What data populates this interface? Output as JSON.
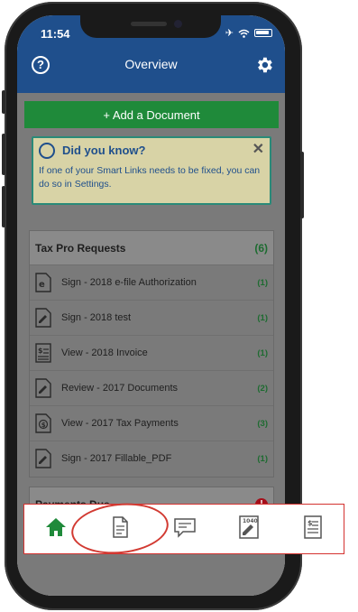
{
  "status_bar": {
    "time": "11:54"
  },
  "nav": {
    "title": "Overview",
    "help_glyph": "?",
    "left_icon": "help-circle-icon",
    "right_icon": "gear-icon"
  },
  "add_document": {
    "label": "+ Add a Document"
  },
  "tip": {
    "title": "Did you know?",
    "body": "If one of your Smart Links needs to be fixed, you can do so in Settings.",
    "close_glyph": "✕"
  },
  "requests": {
    "title": "Tax Pro Requests",
    "count": "(6)",
    "items": [
      {
        "label": "Sign - 2018 e-file Authorization",
        "count": "(1)",
        "icon": "e-file-document-icon"
      },
      {
        "label": "Sign - 2018 test",
        "count": "(1)",
        "icon": "sign-document-icon"
      },
      {
        "label": "View - 2018 Invoice",
        "count": "(1)",
        "icon": "invoice-icon"
      },
      {
        "label": "Review - 2017 Documents",
        "count": "(2)",
        "icon": "review-document-icon"
      },
      {
        "label": "View - 2017 Tax Payments",
        "count": "(3)",
        "icon": "tax-payment-icon"
      },
      {
        "label": "Sign - 2017 Fillable_PDF",
        "count": "(1)",
        "icon": "sign-document-icon"
      }
    ]
  },
  "payments": {
    "title": "Payments Due",
    "alert_glyph": "!"
  },
  "tab_bar": {
    "tabs": [
      {
        "name": "home",
        "icon": "home-icon",
        "active": true
      },
      {
        "name": "documents",
        "icon": "document-icon",
        "active": false
      },
      {
        "name": "messages",
        "icon": "chat-icon",
        "active": false
      },
      {
        "name": "tax-forms",
        "icon": "form-1040-icon",
        "active": false,
        "text": "1040"
      },
      {
        "name": "invoices",
        "icon": "invoice-icon",
        "active": false
      }
    ]
  },
  "colors": {
    "brand_blue": "#1f4f8c",
    "brand_green": "#1f8a3a",
    "highlight_red": "#d4322f"
  }
}
